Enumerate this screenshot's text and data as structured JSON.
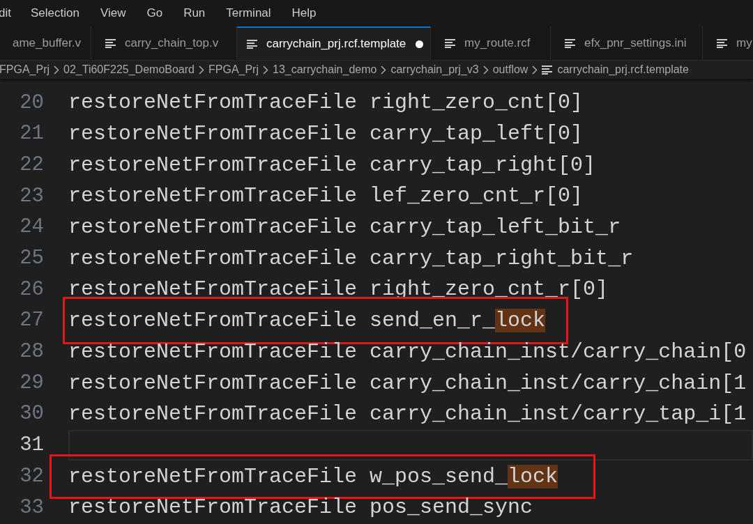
{
  "menu": [
    "dit",
    "Selection",
    "View",
    "Go",
    "Run",
    "Terminal",
    "Help"
  ],
  "tabs": [
    {
      "label": "ame_buffer.v",
      "selected": false,
      "modified": false,
      "icon": false
    },
    {
      "label": "carry_chain_top.v",
      "selected": false,
      "modified": false,
      "icon": true
    },
    {
      "label": "carrychain_prj.rcf.template",
      "selected": true,
      "modified": true,
      "icon": true
    },
    {
      "label": "my_route.rcf",
      "selected": false,
      "modified": false,
      "icon": true
    },
    {
      "label": "efx_pnr_settings.ini",
      "selected": false,
      "modified": false,
      "icon": true
    },
    {
      "label": "my",
      "selected": false,
      "modified": false,
      "icon": true
    }
  ],
  "breadcrumb": [
    "FPGA_Prj",
    "02_Ti60F225_DemoBoard",
    "FPGA_Prj",
    "13_carrychain_demo",
    "carrychain_prj_v3",
    "outflow",
    "carrychain_prj.rcf.template"
  ],
  "lines": [
    {
      "number": "20",
      "current": false,
      "boxed": false,
      "code": [
        {
          "text": "restoreNetFromTraceFile right_zero_cnt[0]",
          "highlighted": false
        }
      ]
    },
    {
      "number": "21",
      "current": false,
      "boxed": false,
      "code": [
        {
          "text": "restoreNetFromTraceFile carry_tap_left[0]",
          "highlighted": false
        }
      ]
    },
    {
      "number": "22",
      "current": false,
      "boxed": false,
      "code": [
        {
          "text": "restoreNetFromTraceFile carry_tap_right[0]",
          "highlighted": false
        }
      ]
    },
    {
      "number": "23",
      "current": false,
      "boxed": false,
      "code": [
        {
          "text": "restoreNetFromTraceFile lef_zero_cnt_r[0]",
          "highlighted": false
        }
      ]
    },
    {
      "number": "24",
      "current": false,
      "boxed": false,
      "code": [
        {
          "text": "restoreNetFromTraceFile carry_tap_left_bit_r",
          "highlighted": false
        }
      ]
    },
    {
      "number": "25",
      "current": false,
      "boxed": false,
      "code": [
        {
          "text": "restoreNetFromTraceFile carry_tap_right_bit_r",
          "highlighted": false
        }
      ]
    },
    {
      "number": "26",
      "current": false,
      "boxed": false,
      "code": [
        {
          "text": "restoreNetFromTraceFile right_zero_cnt_r[0]",
          "highlighted": false
        }
      ]
    },
    {
      "number": "27",
      "current": false,
      "boxed": true,
      "code": [
        {
          "text": "restoreNetFromTraceFile send_en_r_",
          "highlighted": false
        },
        {
          "text": "lock",
          "highlighted": true
        }
      ]
    },
    {
      "number": "28",
      "current": false,
      "boxed": false,
      "code": [
        {
          "text": "restoreNetFromTraceFile carry_chain_inst/carry_chain[0",
          "highlighted": false
        }
      ]
    },
    {
      "number": "29",
      "current": false,
      "boxed": false,
      "code": [
        {
          "text": "restoreNetFromTraceFile carry_chain_inst/carry_chain[1",
          "highlighted": false
        }
      ]
    },
    {
      "number": "30",
      "current": false,
      "boxed": false,
      "code": [
        {
          "text": "restoreNetFromTraceFile carry_chain_inst/carry_tap_i[1",
          "highlighted": false
        }
      ]
    },
    {
      "number": "31",
      "current": true,
      "boxed": false
    },
    {
      "number": "32",
      "current": false,
      "boxed": true,
      "code": [
        {
          "text": "restoreNetFromTraceFile w_pos_send_",
          "highlighted": false
        },
        {
          "text": "lock",
          "highlighted": true
        }
      ]
    },
    {
      "number": "33",
      "current": false,
      "boxed": false,
      "code": [
        {
          "text": "restoreNetFromTraceFile pos_send_sync",
          "highlighted": false
        }
      ]
    }
  ]
}
